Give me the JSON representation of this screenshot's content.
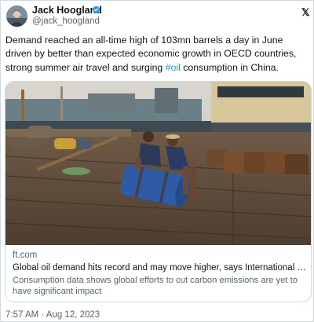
{
  "author": {
    "name": "Jack Hoogland",
    "handle": "@jack_hoogland",
    "verified": true,
    "avatar_icon": "profile-photo"
  },
  "tweet": {
    "text_before": "Demand reached an all-time high of 103mn barrels a day in June driven by better than expected economic growth in OECD countries, strong summer air travel and surging ",
    "hashtag": "#oil",
    "text_after": " consumption in China.",
    "timestamp": "7:57 AM · Aug 12, 2023"
  },
  "card": {
    "domain": "ft.com",
    "title": "Global oil demand hits record and may move higher, says International Energy Agency",
    "description": "Consumption data shows global efforts to cut carbon emissions are yet to have significant impact",
    "image_icon": "photo-workers-rolling-oil-barrel"
  },
  "colors": {
    "link": "#1d9bf0",
    "verified_badge": "#1d9bf0",
    "secondary_text": "#536471",
    "border": "#cfd9de"
  },
  "icons": {
    "verified": "verified-badge-icon",
    "platform": "x-logo-icon"
  }
}
